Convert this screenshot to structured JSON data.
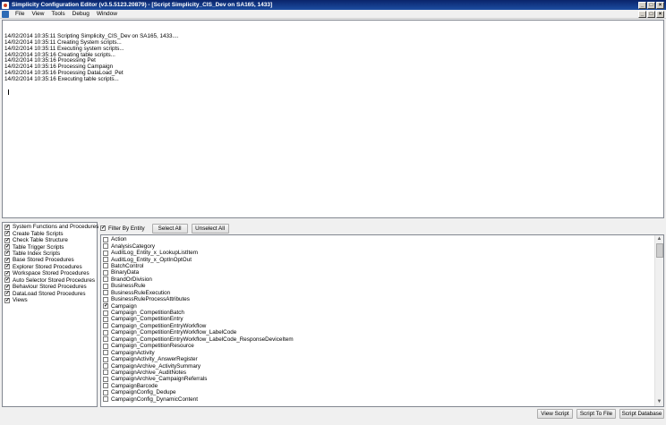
{
  "window": {
    "title": "Simplicity Configuration Editor (v3.5.5123.20879) - [Script Simplicity_CIS_Dev on SA165, 1433]"
  },
  "menu": [
    "File",
    "View",
    "Tools",
    "Debug",
    "Window"
  ],
  "log_lines": [
    "14/02/2014 10:35:11 Scripting Simplicity_CIS_Dev on SA165, 1433....",
    "14/02/2014 10:35:11 Creating System scripts...",
    "14/02/2014 10:35:11 Executing system scripts...",
    "14/02/2014 10:35:16 Creating table scripts...",
    "14/02/2014 10:35:16 Processing Pet",
    "14/02/2014 10:35:16 Processing Campaign",
    "14/02/2014 10:35:16 Processing DataLoad_Pet",
    "14/02/2014 10:35:16 Executing table scripts..."
  ],
  "script_options": [
    {
      "label": "System Functions and Procedures",
      "checked": true
    },
    {
      "label": "Create Table Scripts",
      "checked": true
    },
    {
      "label": "Check Table Structure",
      "checked": true
    },
    {
      "label": "Table Trigger Scripts",
      "checked": true
    },
    {
      "label": "Table Index Scripts",
      "checked": true
    },
    {
      "label": "Base Stored Procedures",
      "checked": true
    },
    {
      "label": "Explorer Stored Procedures",
      "checked": true
    },
    {
      "label": "Workspace Stored Procedures",
      "checked": true
    },
    {
      "label": "Auto Selector Stored Procedures",
      "checked": true
    },
    {
      "label": "Behaviour Stored Procedures",
      "checked": true
    },
    {
      "label": "DataLoad Stored Procedures",
      "checked": true
    },
    {
      "label": "Views",
      "checked": true
    }
  ],
  "filter": {
    "label": "Filter By Entity",
    "checked": true,
    "select_all": "Select All",
    "unselect_all": "Unselect All"
  },
  "entities": [
    {
      "label": "Action",
      "checked": false
    },
    {
      "label": "AnalysisCategory",
      "checked": false
    },
    {
      "label": "AuditLog_Entity_x_LookupListItem",
      "checked": false
    },
    {
      "label": "AuditLog_Entity_x_OptInOptOut",
      "checked": false
    },
    {
      "label": "BatchControl",
      "checked": false
    },
    {
      "label": "BinaryData",
      "checked": false
    },
    {
      "label": "BrandOrDivision",
      "checked": false
    },
    {
      "label": "BusinessRule",
      "checked": false
    },
    {
      "label": "BusinessRuleExecution",
      "checked": false
    },
    {
      "label": "BusinessRuleProcessAttributes",
      "checked": false
    },
    {
      "label": "Campaign",
      "checked": true
    },
    {
      "label": "Campaign_CompetitionBatch",
      "checked": false
    },
    {
      "label": "Campaign_CompetitionEntry",
      "checked": false
    },
    {
      "label": "Campaign_CompetitionEntryWorkflow",
      "checked": false
    },
    {
      "label": "Campaign_CompetitionEntryWorkflow_LabelCode",
      "checked": false
    },
    {
      "label": "Campaign_CompetitionEntryWorkflow_LabelCode_ResponseDeviceItem",
      "checked": false
    },
    {
      "label": "Campaign_CompetitionResource",
      "checked": false
    },
    {
      "label": "CampaignActivity",
      "checked": false
    },
    {
      "label": "CampaignActivity_AnswerRegister",
      "checked": false
    },
    {
      "label": "CampaignArchive_ActivitySummary",
      "checked": false
    },
    {
      "label": "CampaignArchive_AuditNotes",
      "checked": false
    },
    {
      "label": "CampaignArchive_CampaignReferrals",
      "checked": false
    },
    {
      "label": "CampaignBarcode",
      "checked": false
    },
    {
      "label": "CampaignConfig_Dedupe",
      "checked": false
    },
    {
      "label": "CampaignConfig_DynamicContent",
      "checked": false
    }
  ],
  "buttons": {
    "view_script": "View Script",
    "script_to_file": "Script To File",
    "script_database": "Script Database"
  },
  "colors": {
    "titlebar": "#0a246a",
    "background": "#f0f0f0"
  }
}
